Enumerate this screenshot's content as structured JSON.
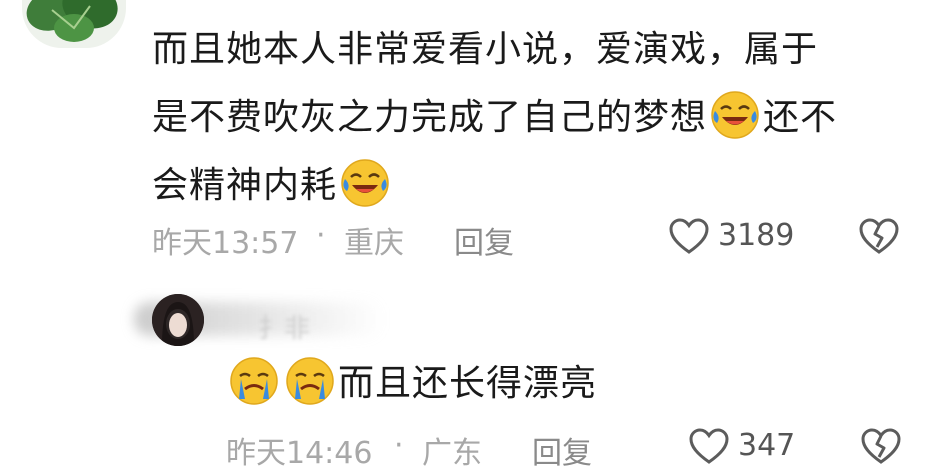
{
  "comment": {
    "avatar_icon": "plant-leaf-avatar",
    "text_line1": "而且她本人非常爱看小说，爱演戏，属于",
    "text_line2_part1": "是不费吹灰之力完成了自己的梦想",
    "text_line2_part2": "还不",
    "text_line3": "会精神内耗",
    "emoji_icon": "laugh-cry-emoji",
    "time": "昨天13:57",
    "separator": "·",
    "location": "重庆",
    "reply_label": "回复",
    "like_icon": "heart-outline-icon",
    "like_count": "3189",
    "dislike_icon": "broken-heart-icon"
  },
  "reply": {
    "avatar_icon": "user-photo-avatar",
    "name_blurred_hint": "扌非",
    "emoji_icon": "crying-emoji",
    "text": "而且还长得漂亮",
    "time": "昨天14:46",
    "separator": "·",
    "location": "广东",
    "reply_label": "回复",
    "like_icon": "heart-outline-icon",
    "like_count": "347",
    "dislike_icon": "broken-heart-icon"
  },
  "colors": {
    "text_primary": "#1a1a1a",
    "text_meta": "#a8a8a8",
    "emoji_yellow": "#f7c531",
    "emoji_tear": "#3a8be0"
  }
}
